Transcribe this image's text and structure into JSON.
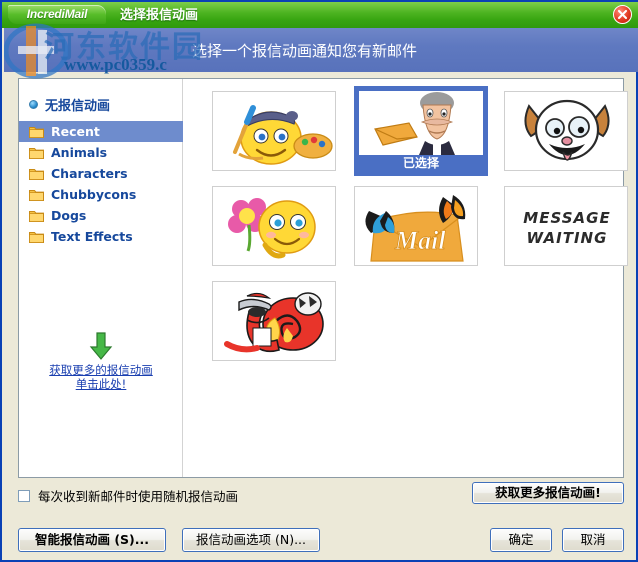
{
  "window": {
    "brand": "IncrediMail",
    "title": "选择报信动画",
    "close_icon": "close-icon"
  },
  "header": {
    "instruction": "选择一个报信动画通知您有新邮件"
  },
  "watermark": {
    "line1": "河东软件园",
    "line2": "www.pc0359.c"
  },
  "sidebar": {
    "no_animation": "无报信动画",
    "folders": [
      {
        "label": "Recent",
        "selected": true
      },
      {
        "label": "Animals",
        "selected": false
      },
      {
        "label": "Characters",
        "selected": false
      },
      {
        "label": "Chubbycons",
        "selected": false
      },
      {
        "label": "Dogs",
        "selected": false
      },
      {
        "label": "Text Effects",
        "selected": false
      }
    ],
    "get_more_line1": "获取更多的报信动画",
    "get_more_line2": "单击此处!",
    "arrow_icon": "down-arrow-icon"
  },
  "grid": {
    "selected_caption": "已选择",
    "items": [
      {
        "name": "painter-smiley",
        "selected": false
      },
      {
        "name": "mustache-man-envelope",
        "selected": true
      },
      {
        "name": "cartoon-dog",
        "selected": false
      },
      {
        "name": "flower-smiley",
        "selected": false
      },
      {
        "name": "butterfly-mail",
        "selected": false
      },
      {
        "name": "message-waiting-text",
        "selected": false
      },
      {
        "name": "racing-snail",
        "selected": false
      }
    ],
    "message_waiting_line1": "MESSAGE",
    "message_waiting_line2": "WAITING",
    "mail_word": "Mail"
  },
  "footer": {
    "random_checkbox_label": "每次收到新邮件时使用随机报信动画",
    "random_checked": false,
    "get_more_button": "获取更多报信动画!",
    "smart_button": "智能报信动画 (S)...",
    "options_button": "报信动画选项 (N)...",
    "ok_button": "确定",
    "cancel_button": "取消"
  },
  "colors": {
    "titlebar_green": "#4cb320",
    "header_blue": "#5f79c0",
    "selection_blue": "#6e8ccd",
    "link_blue": "#1a3fb0",
    "dialog_bg": "#ece9d8"
  }
}
